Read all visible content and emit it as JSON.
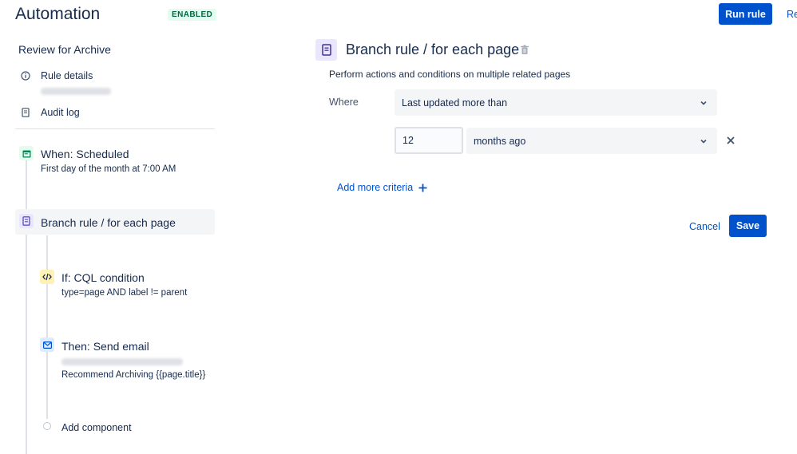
{
  "header": {
    "title": "Automation",
    "status": "ENABLED",
    "run_button": "Run rule",
    "truncated_link": "Re"
  },
  "sidebar": {
    "rule_name": "Review for Archive",
    "links": [
      {
        "label": "Rule details",
        "icon": "info-icon"
      },
      {
        "label": "Audit log",
        "icon": "document-icon"
      }
    ],
    "steps": {
      "trigger": {
        "title": "When: Scheduled",
        "subtitle": "First day of the month at 7:00 AM",
        "icon": "calendar-icon",
        "color": "#00875a"
      },
      "branch": {
        "title": "Branch rule / for each page",
        "icon": "page-icon",
        "color": "#6554c0"
      },
      "condition": {
        "title": "If: CQL condition",
        "subtitle": "type=page AND label != parent",
        "icon": "code-icon",
        "color": "#ffe380"
      },
      "action": {
        "title": "Then: Send email",
        "subtitle": "Recommend Archiving {{page.title}}",
        "icon": "mail-icon",
        "color": "#0052cc"
      },
      "add": {
        "label": "Add component"
      }
    }
  },
  "panel": {
    "title": "Branch rule / for each page",
    "description": "Perform actions and conditions on multiple related pages",
    "where_label": "Where",
    "criteria_select": "Last updated more than",
    "amount_value": "12",
    "unit_select": "months ago",
    "add_criteria": "Add more criteria",
    "cancel": "Cancel",
    "save": "Save"
  },
  "colors": {
    "primary": "#0052cc",
    "badge_bg": "#e3fcef",
    "badge_text": "#006644"
  }
}
